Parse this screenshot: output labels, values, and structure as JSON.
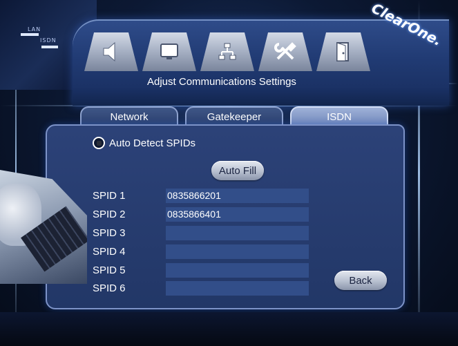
{
  "corner": {
    "lan": "LAN",
    "isdn": "ISDN"
  },
  "brand": "ClearOne.",
  "nav": {
    "icons": [
      "speaker-icon",
      "monitor-icon",
      "network-icon",
      "tools-icon",
      "exit-door-icon"
    ],
    "title": "Adjust Communications Settings"
  },
  "tabs": [
    {
      "label": "Network"
    },
    {
      "label": "Gatekeeper"
    },
    {
      "label": "ISDN",
      "active": true
    }
  ],
  "isdn": {
    "auto_detect_label": "Auto Detect SPIDs",
    "auto_detect_checked": false,
    "auto_fill_label": "Auto Fill",
    "spids": [
      {
        "label": "SPID 1",
        "value": "0835866201"
      },
      {
        "label": "SPID 2",
        "value": "0835866401"
      },
      {
        "label": "SPID 3",
        "value": ""
      },
      {
        "label": "SPID 4",
        "value": ""
      },
      {
        "label": "SPID 5",
        "value": ""
      },
      {
        "label": "SPID 6",
        "value": ""
      }
    ],
    "back_label": "Back"
  },
  "colors": {
    "panel": "#223767",
    "field": "#324e89",
    "accent_glow": "#b4d7ff"
  }
}
